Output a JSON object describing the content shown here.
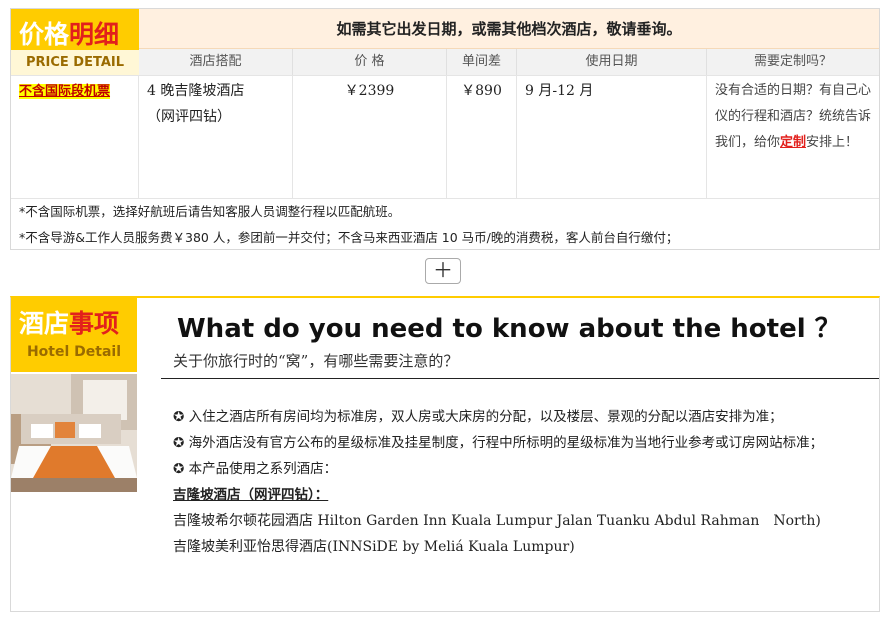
{
  "price": {
    "label_cn_a": "价格",
    "label_cn_b": "明细",
    "label_en": "PRICE DETAIL",
    "notice": "如需其它出发日期，或需其他档次酒店，敬请垂询。",
    "headers": [
      "酒店搭配",
      "价 格",
      "单间差",
      "使用日期",
      "需要定制吗？"
    ],
    "row": {
      "tag": "不含国际段机票",
      "hotel_line1": "4 晚吉隆坡酒店",
      "hotel_line2": "（网评四钻）",
      "price": "￥2399",
      "single_supplement": "￥890",
      "dates": "9 月-12 月",
      "custom_text_a": "没有合适的日期？有自己心仪的行程和酒店？统统告诉我们，给你",
      "custom_link": "定制",
      "custom_text_b": "安排上！"
    },
    "notes": [
      "*不含国际机票，选择好航班后请告知客服人员调整行程以匹配航班。",
      "*不含导游&工作人员服务费￥380 人，参团前一并交付；不含马来西亚酒店 10 马币/晚的消费税，客人前台自行缴付；"
    ]
  },
  "expand_label": "＋",
  "hotel": {
    "label_cn_a": "酒店",
    "label_cn_b": "事项",
    "label_en": "Hotel Detail",
    "title": "What do you need to know about the hotel ？",
    "subtitle": "关于你旅行时的“窝”，有哪些需要注意的？",
    "bullets": [
      "入住之酒店所有房间均为标准房，双人房或大床房的分配，以及楼层、景观的分配以酒店安排为准；",
      "海外酒店没有官方公布的星级标准及挂星制度，行程中所标明的星级标准为当地行业参考或订房网站标准；",
      "本产品使用之系列酒店："
    ],
    "bullet_icon": "✪",
    "heading": "吉隆坡酒店（网评四钻）：",
    "hotels": [
      "吉隆坡希尔顿花园酒店 Hilton Garden Inn Kuala Lumpur Jalan Tuanku Abdul Rahman　North)",
      "吉隆坡美利亚怡思得酒店(INNSiDE by Meliá Kuala Lumpur)"
    ]
  }
}
